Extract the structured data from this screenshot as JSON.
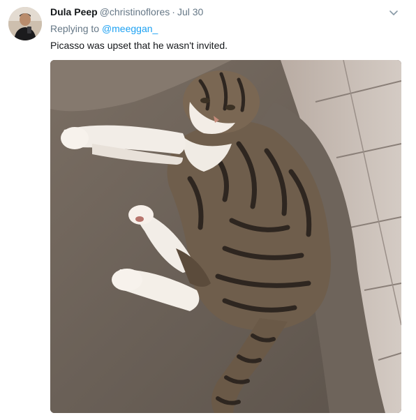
{
  "tweet": {
    "author": {
      "display_name": "Dula Peep",
      "handle": "@christinoflores",
      "avatar_icon": "avatar-photo"
    },
    "separator": "·",
    "timestamp": "Jul 30",
    "reply": {
      "prefix": "Replying to",
      "mention": "@meeggan_"
    },
    "text": "Picasso was upset that he wasn't invited.",
    "menu_icon": "chevron-down-icon",
    "media": {
      "type": "photo",
      "subject": "tabby-cat-on-couch"
    }
  },
  "colors": {
    "text_primary": "#14171a",
    "text_secondary": "#657786",
    "link": "#1da1f2"
  }
}
